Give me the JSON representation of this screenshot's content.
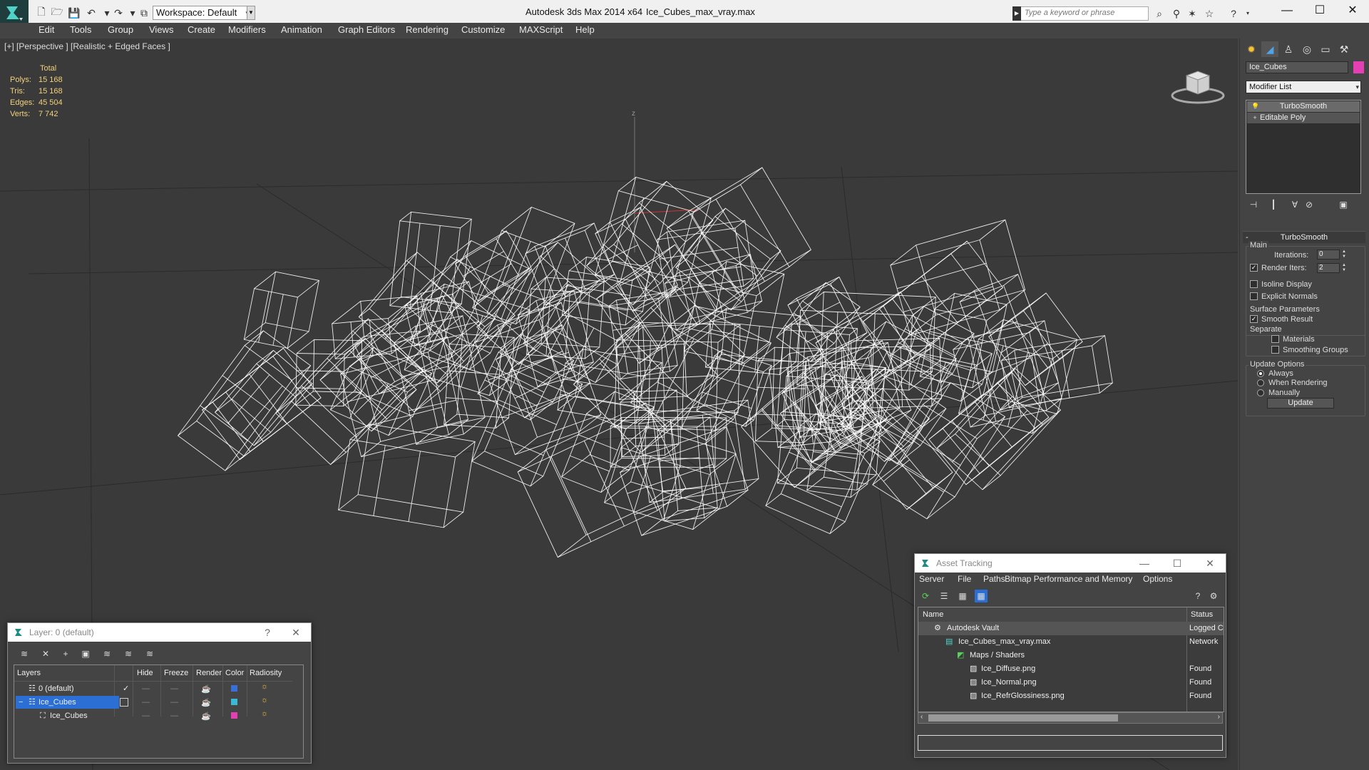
{
  "titlebar": {
    "workspace": "Workspace: Default",
    "app_title": "Autodesk 3ds Max  2014 x64",
    "file_title": "Ice_Cubes_max_vray.max",
    "search_placeholder": "Type a keyword or phrase"
  },
  "menu": [
    "Edit",
    "Tools",
    "Group",
    "Views",
    "Create",
    "Modifiers",
    "Animation",
    "Graph Editors",
    "Rendering",
    "Customize",
    "MAXScript",
    "Help"
  ],
  "viewport": {
    "label": "[+] [Perspective ] [Realistic + Edged Faces ]",
    "stats": {
      "header": "Total",
      "rows": [
        {
          "label": "Polys:",
          "value": "15 168"
        },
        {
          "label": "Tris:",
          "value": "15 168"
        },
        {
          "label": "Edges:",
          "value": "45 504"
        },
        {
          "label": "Verts:",
          "value": "7 742"
        }
      ]
    },
    "axis_label": "z",
    "wire_color": "#ffffff"
  },
  "command_panel": {
    "object_name": "Ice_Cubes",
    "object_color": "#e53fb4",
    "modifier_list": "Modifier List",
    "stack": [
      "TurboSmooth",
      "Editable Poly"
    ],
    "rollout": "TurboSmooth",
    "main_group": "Main",
    "iterations_label": "Iterations:",
    "iterations_value": "0",
    "render_iters_label": "Render Iters:",
    "render_iters_value": "2",
    "isoline_label": "Isoline Display",
    "explicit_label": "Explicit Normals",
    "surface_group": "Surface Parameters",
    "smooth_result_label": "Smooth Result",
    "separate_label": "Separate",
    "materials_label": "Materials",
    "smoothing_groups_label": "Smoothing Groups",
    "update_group": "Update Options",
    "always_label": "Always",
    "when_rendering_label": "When Rendering",
    "manually_label": "Manually",
    "update_button": "Update"
  },
  "layer_window": {
    "title": "Layer: 0 (default)",
    "help": "?",
    "columns": [
      "Layers",
      "Hide",
      "Freeze",
      "Render",
      "Color",
      "Radiosity"
    ],
    "rows": [
      {
        "name": "0 (default)",
        "color": "#3a6fd8"
      },
      {
        "name": "Ice_Cubes",
        "color": "#3ab8d8"
      },
      {
        "name": "Ice_Cubes",
        "color": "#e53fb4"
      }
    ]
  },
  "asset_window": {
    "title": "Asset Tracking",
    "menu": [
      "Server",
      "File",
      "Paths",
      "Bitmap Performance and Memory",
      "Options"
    ],
    "columns": [
      "Name",
      "Status"
    ],
    "rows": [
      {
        "name": "Autodesk Vault",
        "status": "Logged C"
      },
      {
        "name": "Ice_Cubes_max_vray.max",
        "status": "Network"
      },
      {
        "name": "Maps / Shaders",
        "status": ""
      },
      {
        "name": "Ice_Diffuse.png",
        "status": "Found"
      },
      {
        "name": "Ice_Normal.png",
        "status": "Found"
      },
      {
        "name": "Ice_RefrGlossiness.png",
        "status": "Found"
      }
    ]
  }
}
